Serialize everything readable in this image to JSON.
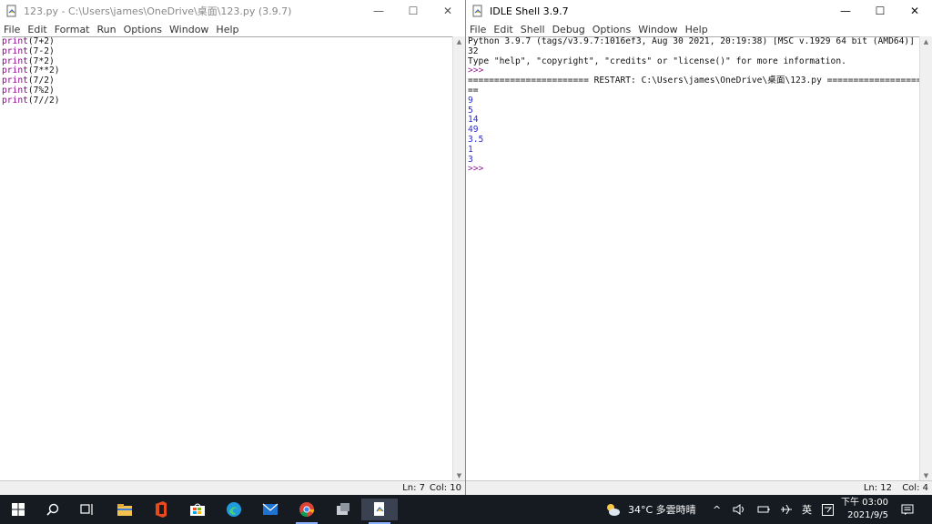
{
  "editor": {
    "title": "123.py - C:\\Users\\james\\OneDrive\\桌面\\123.py (3.9.7)",
    "menu": [
      "File",
      "Edit",
      "Format",
      "Run",
      "Options",
      "Window",
      "Help"
    ],
    "code_lines": [
      {
        "kw": "print",
        "rest": "(7+2)"
      },
      {
        "kw": "print",
        "rest": "(7-2)"
      },
      {
        "kw": "print",
        "rest": "(7*2)"
      },
      {
        "kw": "print",
        "rest": "(7**2)"
      },
      {
        "kw": "print",
        "rest": "(7/2)"
      },
      {
        "kw": "print",
        "rest": "(7%2)"
      },
      {
        "kw": "print",
        "rest": "(7//2)"
      }
    ],
    "status_ln": "Ln: 7",
    "status_col": "Col: 10"
  },
  "shell": {
    "title": "IDLE Shell 3.9.7",
    "menu": [
      "File",
      "Edit",
      "Shell",
      "Debug",
      "Options",
      "Window",
      "Help"
    ],
    "banner1": "Python 3.9.7 (tags/v3.9.7:1016ef3, Aug 30 2021, 20:19:38) [MSC v.1929 64 bit (AMD64)] on win",
    "banner2": "32",
    "banner3": "Type \"help\", \"copyright\", \"credits\" or \"license()\" for more information.",
    "prompt": ">>>",
    "restart1": "======================= RESTART: C:\\Users\\james\\OneDrive\\桌面\\123.py =======================",
    "restart2": "==",
    "outputs": [
      "9",
      "5",
      "14",
      "49",
      "3.5",
      "1",
      "3"
    ],
    "status_ln": "Ln: 12",
    "status_col": "Col: 4"
  },
  "taskbar": {
    "weather": "34°C 多雲時晴",
    "ime": "英",
    "time": "下午 03:00",
    "date": "2021/9/5"
  }
}
